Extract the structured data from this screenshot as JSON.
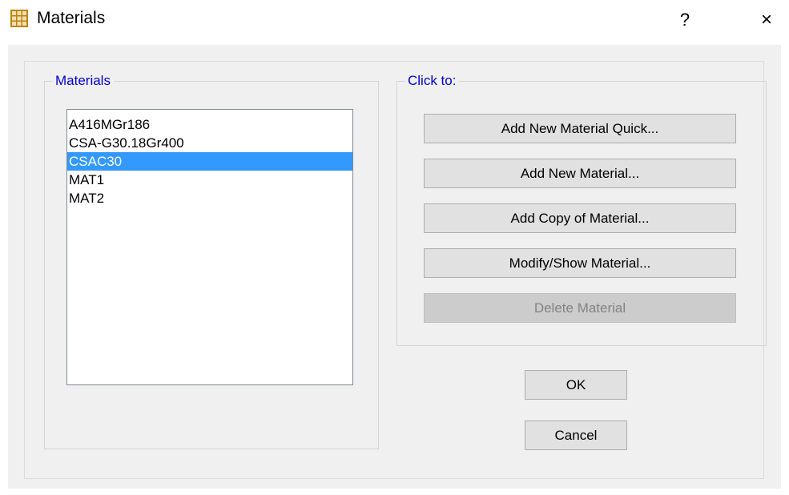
{
  "window": {
    "title": "Materials",
    "help_label": "?",
    "close_label": "×"
  },
  "materials_group": {
    "title": "Materials",
    "items": [
      "A416MGr186",
      "CSA-G30.18Gr400",
      "CSAC30",
      "MAT1",
      "MAT2"
    ],
    "selected": "CSAC30"
  },
  "click_group": {
    "title": "Click to:",
    "buttons": {
      "add_quick": "Add New Material Quick...",
      "add_new": "Add New Material...",
      "add_copy": "Add Copy of Material...",
      "modify": "Modify/Show Material...",
      "delete": "Delete Material"
    }
  },
  "dialog_buttons": {
    "ok": "OK",
    "cancel": "Cancel"
  },
  "colors": {
    "selection": "#3399ff",
    "group_title": "#0000cc",
    "dialog_bg": "#f0f0f0"
  }
}
